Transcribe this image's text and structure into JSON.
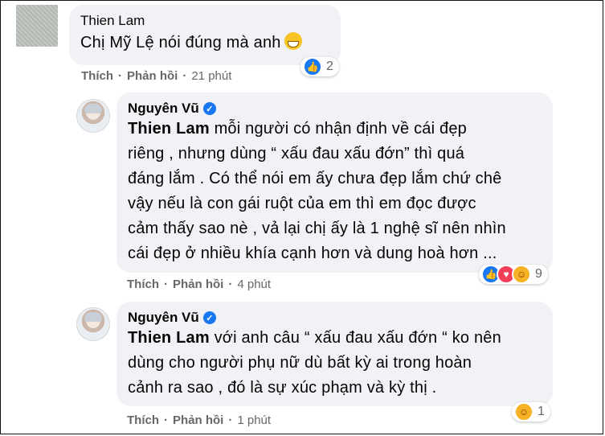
{
  "comments": [
    {
      "author": "Thien Lam",
      "text": "Chị Mỹ Lệ nói đúng mà anh",
      "emoji": "grin-emoji",
      "reactions": {
        "icons": [
          "like"
        ],
        "count": "2"
      },
      "actions": {
        "like": "Thích",
        "reply": "Phản hồi",
        "time": "21 phút"
      }
    },
    {
      "author": "Nguyên Vũ",
      "verified": true,
      "mention": "Thien Lam",
      "lines": [
        " mỗi người có nhận định về cái đẹp",
        "riêng , nhưng dùng “ xấu đau xấu đớn” thì quá",
        "đáng lắm . Có thể nói em ấy chưa đẹp lắm chứ chê",
        "vậy nếu là con gái ruột của em thì em đọc được",
        "cảm thấy sao nè , vả lại chị ấy là 1 nghệ sĩ nên nhìn",
        "cái đẹp ở nhiều khía cạnh hơn và dung hoà hơn ..."
      ],
      "reactions": {
        "icons": [
          "like",
          "love",
          "care"
        ],
        "count": "9"
      },
      "actions": {
        "like": "Thích",
        "reply": "Phản hồi",
        "time": "4 phút"
      }
    },
    {
      "author": "Nguyên Vũ",
      "verified": true,
      "mention": "Thien Lam",
      "lines": [
        " với anh câu “ xấu đau xấu đớn “ ko nên",
        "dùng cho người phụ nữ dù bất kỳ ai trong hoàn",
        "cảnh ra sao , đó là sự xúc phạm và kỳ thị ."
      ],
      "reactions": {
        "icons": [
          "care"
        ],
        "count": "1"
      },
      "actions": {
        "like": "Thích",
        "reply": "Phản hồi",
        "time": "1 phút"
      }
    }
  ],
  "colors": {
    "bubble": "#f0f2f5",
    "meta": "#65676b",
    "like": "#1877f2",
    "love": "#f33e58",
    "care": "#f7b125"
  }
}
